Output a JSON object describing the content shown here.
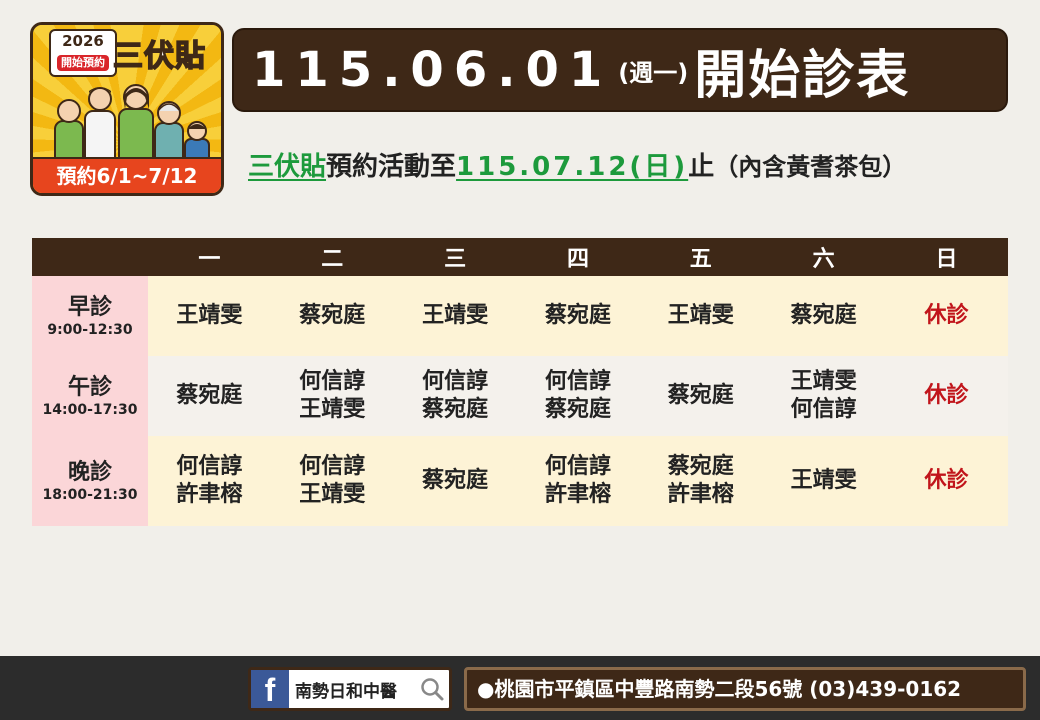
{
  "badge": {
    "year": "2026",
    "pill": "開始預約",
    "title": "三伏貼",
    "footer": "預約6/1~7/12"
  },
  "banner": {
    "date": "115.06.01",
    "weekday": "(週一)",
    "label": "開始診表"
  },
  "subtitle": {
    "event": "三伏貼",
    "text1": "預約活動至",
    "end_date": "115.07.12(日)",
    "text2": "止",
    "note": "（內含黃耆茶包）"
  },
  "schedule": {
    "days": [
      "一",
      "二",
      "三",
      "四",
      "五",
      "六",
      "日"
    ],
    "sessions": [
      {
        "name": "早診",
        "time": "9:00-12:30",
        "cells": [
          [
            "王靖雯"
          ],
          [
            "蔡宛庭"
          ],
          [
            "王靖雯"
          ],
          [
            "蔡宛庭"
          ],
          [
            "王靖雯"
          ],
          [
            "蔡宛庭"
          ],
          [
            "休診"
          ]
        ]
      },
      {
        "name": "午診",
        "time": "14:00-17:30",
        "cells": [
          [
            "蔡宛庭"
          ],
          [
            "何信諄",
            "王靖雯"
          ],
          [
            "何信諄",
            "蔡宛庭"
          ],
          [
            "何信諄",
            "蔡宛庭"
          ],
          [
            "蔡宛庭"
          ],
          [
            "王靖雯",
            "何信諄"
          ],
          [
            "休診"
          ]
        ]
      },
      {
        "name": "晚診",
        "time": "18:00-21:30",
        "cells": [
          [
            "何信諄",
            "許聿榕"
          ],
          [
            "何信諄",
            "王靖雯"
          ],
          [
            "蔡宛庭"
          ],
          [
            "何信諄",
            "許聿榕"
          ],
          [
            "蔡宛庭",
            "許聿榕"
          ],
          [
            "王靖雯"
          ],
          [
            "休診"
          ]
        ]
      }
    ]
  },
  "footer": {
    "fb_letter": "f",
    "fb_name": "南勢日和中醫",
    "address": "●桃園市平鎮區中豐路南勢二段56號 (03)439-0162"
  },
  "colors": {
    "brown": "#3e2817",
    "green": "#1d9a3c",
    "rest_red": "#c1151b",
    "session_pink": "#fbd6d8",
    "cell_cream": "#fdf3d6"
  }
}
